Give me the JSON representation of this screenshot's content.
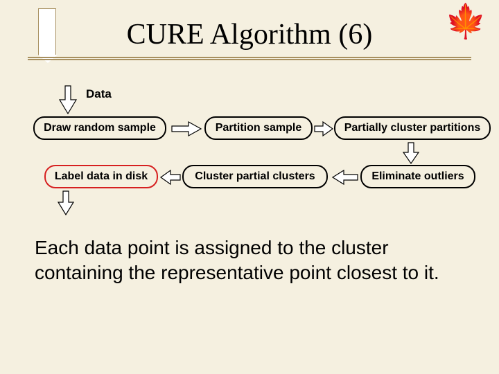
{
  "title": "CURE Algorithm (6)",
  "data_label": "Data",
  "boxes": {
    "draw": "Draw random sample",
    "partition": "Partition sample",
    "partial": "Partially cluster partitions",
    "label": "Label data in disk",
    "cluster": "Cluster partial clusters",
    "eliminate": "Eliminate outliers"
  },
  "body": "Each data point is assigned to the cluster containing the representative point closest to it."
}
